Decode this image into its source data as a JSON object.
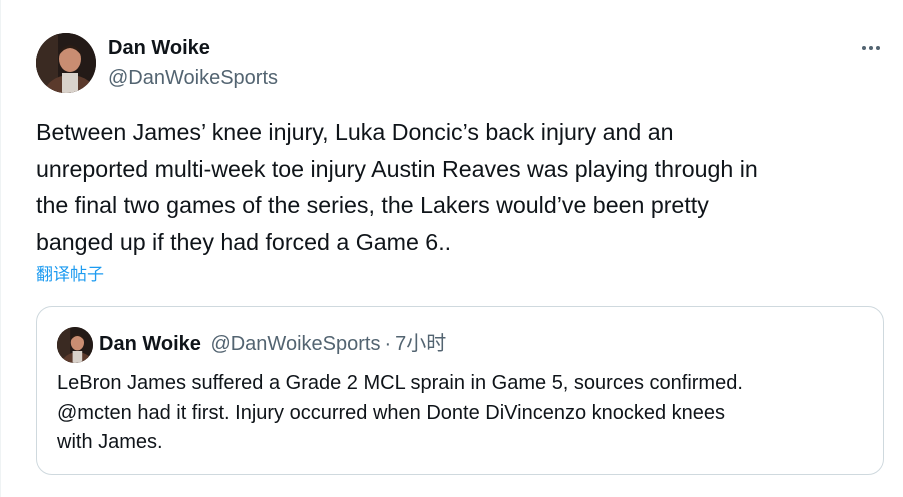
{
  "tweet": {
    "author_name": "Dan Woike",
    "author_handle": "@DanWoikeSports",
    "more_icon": "more-horizontal-icon",
    "text": "Between James’ knee injury, Luka Doncic’s back injury and an\nunreported multi-week toe injury Austin Reaves was playing through in\nthe final two games of the series, the Lakers would’ve been pretty\nbanged up if they had forced a Game 6..",
    "translate_label": "翻译帖子"
  },
  "quoted": {
    "author_name": "Dan Woike",
    "author_handle": "@DanWoikeSports",
    "separator": "·",
    "time": "7小时",
    "text": "LeBron James suffered a Grade 2 MCL sprain in Game 5, sources confirmed.\n@mcten had it first. Injury occurred when Donte DiVincenzo knocked knees\nwith James."
  },
  "colors": {
    "text_primary": "#0f1419",
    "text_secondary": "#536471",
    "link": "#1d9bf0",
    "border": "#cfd9de"
  }
}
